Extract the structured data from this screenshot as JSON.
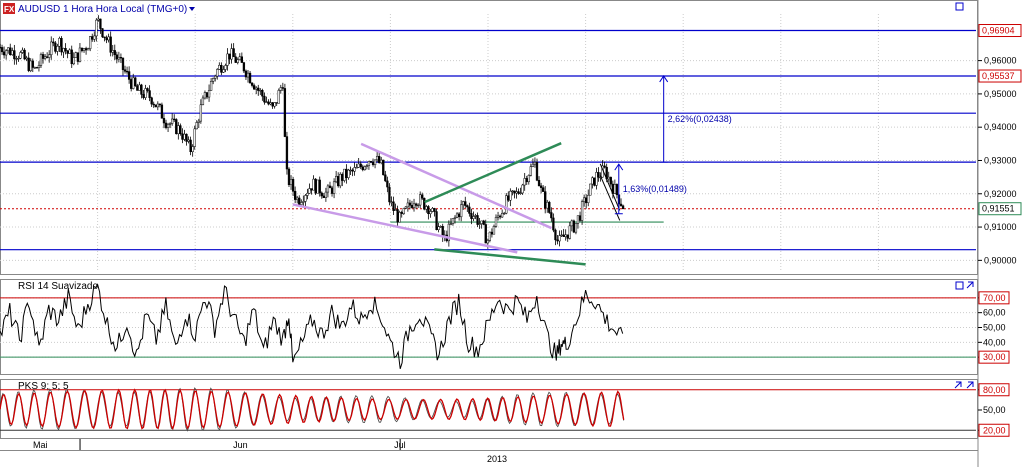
{
  "header": {
    "symbol_title": "AUDUSD 1 Hora Hora Local (TMG+0)",
    "fx_icon_text": "FX",
    "dropdown_icon": "chevron-down-icon",
    "window_icon": "window-square-icon"
  },
  "colors": {
    "hline": "#0000cc",
    "candle": "#000000",
    "price_dotted": "#d00000",
    "green_line": "#2e8b57",
    "purple_line": "#c89be8",
    "rsi_line": "#000000",
    "pks_line": "#cc0000",
    "grid": "#cccccc",
    "label_red_border": "#cc0000",
    "label_green_border": "#2e8b57"
  },
  "chart_data": [
    {
      "type": "candlestick",
      "panel": "price",
      "title": "AUDUSD 1 Hora Hora Local (TMG+0)",
      "ylim": [
        0.8965,
        0.974
      ],
      "y_ticks": [
        "0,96000",
        "0,95000",
        "0,94000",
        "0,93000",
        "0,92000",
        "0,91000",
        "0,90000"
      ],
      "y_tick_values": [
        0.96,
        0.95,
        0.94,
        0.93,
        0.92,
        0.91,
        0.9
      ],
      "grid": true,
      "horizontal_levels": [
        0.96904,
        0.95537,
        0.9442,
        0.9295,
        0.9032
      ],
      "level_labels": [
        {
          "text": "0,96904",
          "value": 0.96904,
          "style": "red"
        },
        {
          "text": "0,95537",
          "value": 0.95537,
          "style": "red"
        },
        {
          "text": "0,91551",
          "value": 0.91551,
          "style": "green"
        }
      ],
      "current_price": 0.91551,
      "support_line": 0.9115,
      "annotations": [
        {
          "text": "2,62%(0,02438)",
          "t": 0.68,
          "from": 0.9295,
          "to": 0.9554
        },
        {
          "text": "1,63%(0,01489)",
          "t": 0.634,
          "from": 0.914,
          "to": 0.9289
        }
      ],
      "trendlines": [
        {
          "color": "purple",
          "points": [
            [
              0.3,
              0.9168
            ],
            [
              0.53,
              0.9024
            ]
          ]
        },
        {
          "color": "purple",
          "points": [
            [
              0.37,
              0.935
            ],
            [
              0.565,
              0.9097
            ]
          ]
        },
        {
          "color": "green",
          "points": [
            [
              0.435,
              0.9175
            ],
            [
              0.575,
              0.9352
            ]
          ]
        },
        {
          "color": "green",
          "points": [
            [
              0.445,
              0.9033
            ],
            [
              0.6,
              0.8988
            ]
          ]
        },
        {
          "color": "dark",
          "points": [
            [
              0.615,
              0.929
            ],
            [
              0.635,
              0.915
            ]
          ]
        },
        {
          "color": "dark",
          "points": [
            [
              0.615,
              0.9255
            ],
            [
              0.635,
              0.912
            ]
          ]
        }
      ],
      "path": [
        [
          0.0,
          0.964
        ],
        [
          0.02,
          0.962
        ],
        [
          0.035,
          0.957
        ],
        [
          0.045,
          0.961
        ],
        [
          0.06,
          0.966
        ],
        [
          0.075,
          0.96
        ],
        [
          0.09,
          0.965
        ],
        [
          0.1,
          0.972
        ],
        [
          0.11,
          0.966
        ],
        [
          0.125,
          0.958
        ],
        [
          0.14,
          0.951
        ],
        [
          0.155,
          0.949
        ],
        [
          0.17,
          0.942
        ],
        [
          0.185,
          0.939
        ],
        [
          0.195,
          0.933
        ],
        [
          0.205,
          0.945
        ],
        [
          0.22,
          0.956
        ],
        [
          0.235,
          0.962
        ],
        [
          0.25,
          0.958
        ],
        [
          0.265,
          0.951
        ],
        [
          0.28,
          0.945
        ],
        [
          0.29,
          0.954
        ],
        [
          0.293,
          0.926
        ],
        [
          0.305,
          0.918
        ],
        [
          0.32,
          0.923
        ],
        [
          0.335,
          0.92
        ],
        [
          0.35,
          0.925
        ],
        [
          0.365,
          0.927
        ],
        [
          0.38,
          0.931
        ],
        [
          0.39,
          0.929
        ],
        [
          0.4,
          0.917
        ],
        [
          0.41,
          0.912
        ],
        [
          0.425,
          0.919
        ],
        [
          0.44,
          0.916
        ],
        [
          0.455,
          0.906
        ],
        [
          0.465,
          0.912
        ],
        [
          0.475,
          0.917
        ],
        [
          0.49,
          0.912
        ],
        [
          0.5,
          0.906
        ],
        [
          0.51,
          0.913
        ],
        [
          0.52,
          0.918
        ],
        [
          0.53,
          0.92
        ],
        [
          0.54,
          0.926
        ],
        [
          0.548,
          0.929
        ],
        [
          0.555,
          0.92
        ],
        [
          0.565,
          0.913
        ],
        [
          0.572,
          0.905
        ],
        [
          0.58,
          0.908
        ],
        [
          0.59,
          0.911
        ],
        [
          0.6,
          0.918
        ],
        [
          0.61,
          0.925
        ],
        [
          0.62,
          0.927
        ],
        [
          0.63,
          0.921
        ],
        [
          0.64,
          0.9155
        ]
      ]
    },
    {
      "type": "line",
      "panel": "rsi",
      "title": "RSI 14 Suavizado",
      "ylim": [
        20,
        80
      ],
      "y_ticks": [
        "70,00",
        "60,00",
        "50,00",
        "40,00",
        "30,00"
      ],
      "y_tick_values": [
        70,
        60,
        50,
        40,
        30
      ],
      "levels": [
        70,
        30
      ],
      "grid": true,
      "path": [
        [
          0.0,
          45
        ],
        [
          0.01,
          60
        ],
        [
          0.02,
          42
        ],
        [
          0.03,
          68
        ],
        [
          0.04,
          35
        ],
        [
          0.05,
          62
        ],
        [
          0.06,
          55
        ],
        [
          0.07,
          70
        ],
        [
          0.08,
          48
        ],
        [
          0.09,
          66
        ],
        [
          0.1,
          78
        ],
        [
          0.11,
          52
        ],
        [
          0.12,
          36
        ],
        [
          0.13,
          55
        ],
        [
          0.14,
          30
        ],
        [
          0.15,
          58
        ],
        [
          0.16,
          42
        ],
        [
          0.17,
          64
        ],
        [
          0.18,
          35
        ],
        [
          0.19,
          60
        ],
        [
          0.2,
          45
        ],
        [
          0.21,
          72
        ],
        [
          0.22,
          50
        ],
        [
          0.23,
          75
        ],
        [
          0.24,
          55
        ],
        [
          0.25,
          40
        ],
        [
          0.26,
          62
        ],
        [
          0.27,
          33
        ],
        [
          0.28,
          55
        ],
        [
          0.29,
          42
        ],
        [
          0.296,
          60
        ],
        [
          0.3,
          25
        ],
        [
          0.31,
          40
        ],
        [
          0.32,
          55
        ],
        [
          0.33,
          45
        ],
        [
          0.34,
          60
        ],
        [
          0.35,
          50
        ],
        [
          0.36,
          65
        ],
        [
          0.37,
          55
        ],
        [
          0.38,
          68
        ],
        [
          0.39,
          58
        ],
        [
          0.4,
          40
        ],
        [
          0.41,
          28
        ],
        [
          0.42,
          50
        ],
        [
          0.43,
          60
        ],
        [
          0.44,
          45
        ],
        [
          0.45,
          32
        ],
        [
          0.46,
          55
        ],
        [
          0.47,
          68
        ],
        [
          0.48,
          40
        ],
        [
          0.49,
          35
        ],
        [
          0.5,
          52
        ],
        [
          0.51,
          70
        ],
        [
          0.52,
          62
        ],
        [
          0.53,
          68
        ],
        [
          0.54,
          55
        ],
        [
          0.55,
          72
        ],
        [
          0.56,
          45
        ],
        [
          0.57,
          30
        ],
        [
          0.575,
          40
        ],
        [
          0.58,
          38
        ],
        [
          0.59,
          55
        ],
        [
          0.6,
          72
        ],
        [
          0.61,
          68
        ],
        [
          0.62,
          56
        ],
        [
          0.63,
          48
        ],
        [
          0.64,
          40
        ]
      ]
    },
    {
      "type": "line",
      "panel": "pks",
      "title": "PKS 9; 5; 5",
      "ylim": [
        10,
        90
      ],
      "y_ticks": [
        "80,00",
        "50,00",
        "20,00"
      ],
      "y_tick_values": [
        80,
        50,
        20
      ],
      "levels": [
        80,
        20
      ],
      "grid": true,
      "x_ticks": [
        "Mai",
        "Jun",
        "Jul"
      ],
      "x_tick_positions": [
        0.04,
        0.245,
        0.41
      ],
      "x_separators": [
        0.082,
        0.41
      ],
      "year_label": "2013",
      "cycle": 0.0165,
      "amplitude": [
        22,
        80
      ],
      "end": 0.64,
      "end_value": 52
    }
  ]
}
